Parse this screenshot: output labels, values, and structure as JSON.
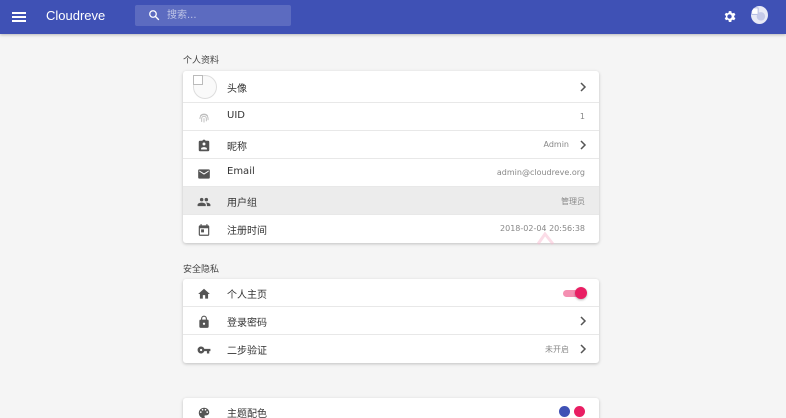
{
  "app": {
    "title": "Cloudreve"
  },
  "search": {
    "placeholder": "搜索..."
  },
  "colors": {
    "primary": "#3f51b5",
    "accent": "#e91e63"
  },
  "icons": {
    "menu": "menu-icon",
    "search": "search-icon",
    "settings": "gear-icon",
    "avatar": "avatar-icon",
    "uid": "fingerprint-icon",
    "nickname": "badge-icon",
    "email": "mail-icon",
    "group": "people-icon",
    "registered": "calendar-icon",
    "homepage": "home-icon",
    "password": "lock-icon",
    "two_factor": "key-icon",
    "theme": "palette-icon",
    "chevron": "chevron-right-icon"
  },
  "profile": {
    "section_title": "个人资料",
    "avatar": {
      "label": "头像"
    },
    "uid": {
      "label": "UID",
      "value": "1"
    },
    "nickname": {
      "label": "昵称",
      "value": "Admin"
    },
    "email": {
      "label": "Email",
      "value": "admin@cloudreve.org"
    },
    "group": {
      "label": "用户组",
      "value": "管理员"
    },
    "registered": {
      "label": "注册时间",
      "value": "2018-02-04 20:56:38"
    }
  },
  "security": {
    "section_title": "安全隐私",
    "homepage": {
      "label": "个人主页",
      "enabled": true
    },
    "password": {
      "label": "登录密码"
    },
    "two_factor": {
      "label": "二步验证",
      "value": "未开启"
    }
  },
  "appearance": {
    "theme": {
      "label": "主题配色",
      "swatches": [
        "#3f51b5",
        "#e91e63"
      ]
    }
  }
}
